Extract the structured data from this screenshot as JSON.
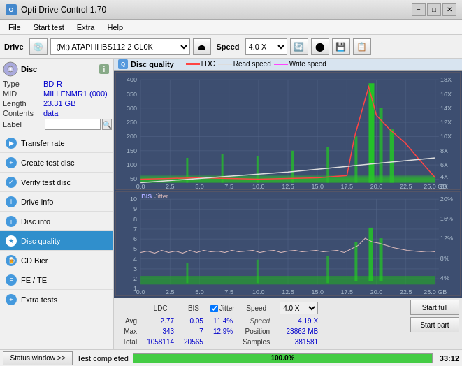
{
  "titlebar": {
    "title": "Opti Drive Control 1.70",
    "icon_text": "O",
    "btn_minimize": "−",
    "btn_restore": "□",
    "btn_close": "✕"
  },
  "menubar": {
    "items": [
      "File",
      "Start test",
      "Extra",
      "Help"
    ]
  },
  "toolbar": {
    "drive_label": "Drive",
    "drive_value": "(M:) ATAPI iHBS112  2 CL0K",
    "speed_label": "Speed",
    "speed_value": "4.0 X"
  },
  "disc": {
    "title": "Disc",
    "type_label": "Type",
    "type_value": "BD-R",
    "mid_label": "MID",
    "mid_value": "MILLENMR1 (000)",
    "length_label": "Length",
    "length_value": "23.31 GB",
    "contents_label": "Contents",
    "contents_value": "data",
    "label_label": "Label",
    "label_value": ""
  },
  "nav": {
    "items": [
      {
        "id": "transfer-rate",
        "label": "Transfer rate",
        "active": false
      },
      {
        "id": "create-test-disc",
        "label": "Create test disc",
        "active": false
      },
      {
        "id": "verify-test-disc",
        "label": "Verify test disc",
        "active": false
      },
      {
        "id": "drive-info",
        "label": "Drive info",
        "active": false
      },
      {
        "id": "disc-info",
        "label": "Disc info",
        "active": false
      },
      {
        "id": "disc-quality",
        "label": "Disc quality",
        "active": true
      },
      {
        "id": "cd-bier",
        "label": "CD Bier",
        "active": false
      },
      {
        "id": "fe-te",
        "label": "FE / TE",
        "active": false
      },
      {
        "id": "extra-tests",
        "label": "Extra tests",
        "active": false
      }
    ]
  },
  "chart": {
    "title": "Disc quality",
    "legend": {
      "ldc_label": "LDC",
      "ldc_color": "#ff4444",
      "read_label": "Read speed",
      "read_color": "#ffffff",
      "write_label": "Write speed",
      "write_color": "#ff44ff"
    },
    "upper": {
      "y_max": 400,
      "y_labels": [
        "400",
        "350",
        "300",
        "250",
        "200",
        "150",
        "100",
        "50"
      ],
      "y_right": [
        "18X",
        "16X",
        "14X",
        "12X",
        "10X",
        "8X",
        "6X",
        "4X",
        "2X"
      ],
      "x_labels": [
        "0.0",
        "2.5",
        "5.0",
        "7.5",
        "10.0",
        "12.5",
        "15.0",
        "17.5",
        "20.0",
        "22.5",
        "25.0"
      ]
    },
    "lower": {
      "title2": "BIS",
      "jitter_label": "Jitter",
      "y_labels": [
        "10",
        "9",
        "8",
        "7",
        "6",
        "5",
        "4",
        "3",
        "2",
        "1"
      ],
      "y_right": [
        "20%",
        "16%",
        "12%",
        "8%",
        "4%"
      ],
      "x_labels": [
        "0.0",
        "2.5",
        "5.0",
        "7.5",
        "10.0",
        "12.5",
        "15.0",
        "17.5",
        "20.0",
        "22.5",
        "25.0"
      ]
    }
  },
  "stats": {
    "col_headers": [
      "",
      "LDC",
      "BIS",
      "",
      "Jitter",
      "Speed",
      "",
      ""
    ],
    "avg_label": "Avg",
    "avg_ldc": "2.77",
    "avg_bis": "0.05",
    "avg_jitter": "11.4%",
    "avg_speed": "4.19 X",
    "speed_select": "4.0 X",
    "max_label": "Max",
    "max_ldc": "343",
    "max_bis": "7",
    "max_jitter": "12.9%",
    "position_label": "Position",
    "position_value": "23862 MB",
    "total_label": "Total",
    "total_ldc": "1058114",
    "total_bis": "20565",
    "samples_label": "Samples",
    "samples_value": "381581",
    "start_full": "Start full",
    "start_part": "Start part",
    "jitter_checked": true
  },
  "statusbar": {
    "status_window_btn": "Status window >>",
    "status_text": "Test completed",
    "progress_pct": 100,
    "progress_label": "100.0%",
    "time": "33:12"
  }
}
